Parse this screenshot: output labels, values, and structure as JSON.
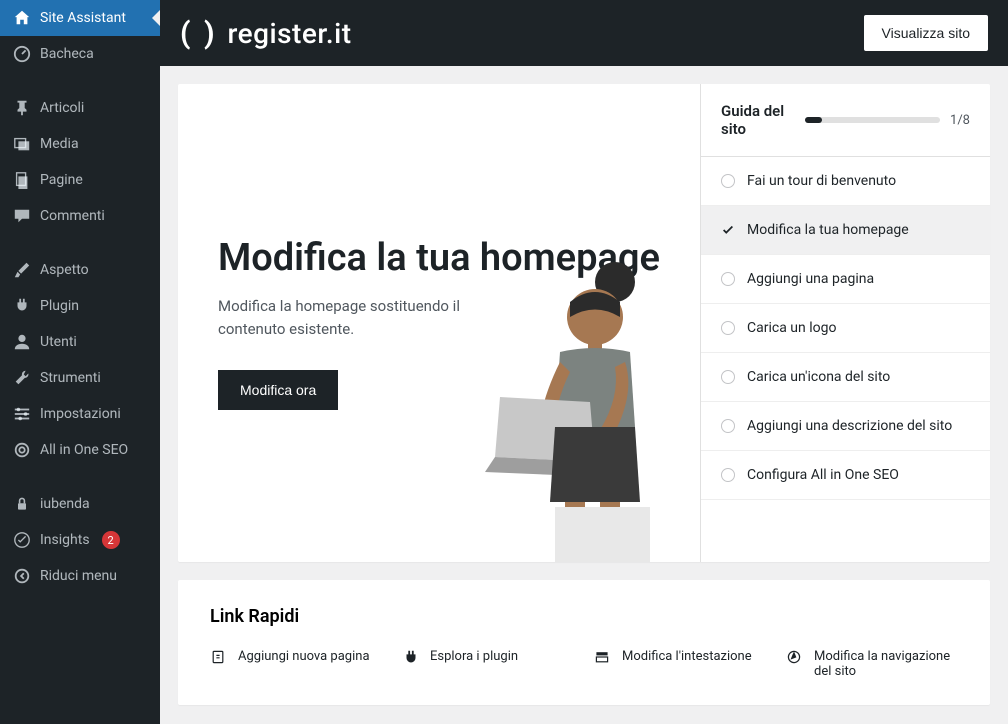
{
  "sidebar": {
    "items": [
      {
        "label": "Site Assistant",
        "icon": "home",
        "active": true
      },
      {
        "label": "Bacheca",
        "icon": "dashboard"
      },
      {
        "spacer": true
      },
      {
        "label": "Articoli",
        "icon": "pin"
      },
      {
        "label": "Media",
        "icon": "media"
      },
      {
        "label": "Pagine",
        "icon": "page"
      },
      {
        "label": "Commenti",
        "icon": "comment"
      },
      {
        "spacer": true
      },
      {
        "label": "Aspetto",
        "icon": "brush"
      },
      {
        "label": "Plugin",
        "icon": "plug"
      },
      {
        "label": "Utenti",
        "icon": "user"
      },
      {
        "label": "Strumenti",
        "icon": "wrench"
      },
      {
        "label": "Impostazioni",
        "icon": "sliders"
      },
      {
        "label": "All in One SEO",
        "icon": "seo"
      },
      {
        "spacer": true
      },
      {
        "label": "iubenda",
        "icon": "lock"
      },
      {
        "label": "Insights",
        "icon": "insights",
        "badge": "2"
      },
      {
        "label": "Riduci menu",
        "icon": "collapse"
      }
    ]
  },
  "topbar": {
    "brand": "register.it",
    "visit_label": "Visualizza sito"
  },
  "hero": {
    "title": "Modifica la tua homepage",
    "desc": "Modifica la homepage sostituendo il contenuto esistente.",
    "cta": "Modifica ora"
  },
  "guide": {
    "title": "Guida del sito",
    "progress": "1/8",
    "items": [
      {
        "label": "Fai un tour di benvenuto",
        "state": "pending"
      },
      {
        "label": "Modifica la tua homepage",
        "state": "done"
      },
      {
        "label": "Aggiungi una pagina",
        "state": "pending"
      },
      {
        "label": "Carica un logo",
        "state": "pending"
      },
      {
        "label": "Carica un'icona del sito",
        "state": "pending"
      },
      {
        "label": "Aggiungi una descrizione del sito",
        "state": "pending"
      },
      {
        "label": "Configura All in One SEO",
        "state": "pending"
      }
    ]
  },
  "quick": {
    "title": "Link Rapidi",
    "items": [
      {
        "label": "Aggiungi nuova pagina",
        "icon": "page-plus"
      },
      {
        "label": "Esplora i plugin",
        "icon": "plug"
      },
      {
        "label": "Modifica l'intestazione",
        "icon": "header"
      },
      {
        "label": "Modifica la navigazione del sito",
        "icon": "nav"
      }
    ]
  }
}
